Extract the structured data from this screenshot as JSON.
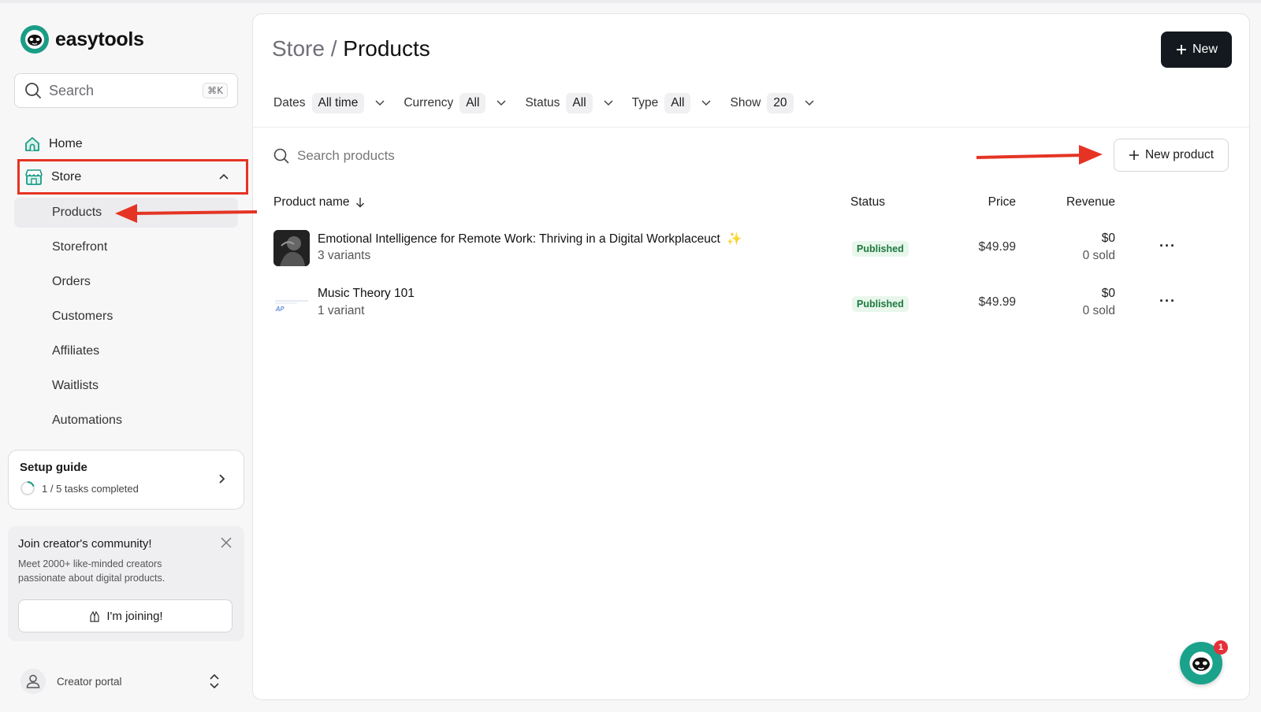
{
  "brand": {
    "name": "easytools"
  },
  "sidebar": {
    "search_placeholder": "Search",
    "search_shortcut": "⌘K",
    "home_label": "Home",
    "store_label": "Store",
    "store_items": [
      {
        "label": "Products",
        "active": true
      },
      {
        "label": "Storefront"
      },
      {
        "label": "Orders"
      },
      {
        "label": "Customers"
      },
      {
        "label": "Affiliates"
      },
      {
        "label": "Waitlists"
      },
      {
        "label": "Automations"
      }
    ],
    "setup_guide": {
      "title": "Setup guide",
      "progress_text": "1 / 5 tasks completed",
      "progress": 0.2
    },
    "community": {
      "title": "Join creator's community!",
      "description": "Meet 2000+ like-minded creators passionate about digital products.",
      "button_label": "I'm joining!"
    },
    "portal_label": "Creator portal"
  },
  "header": {
    "breadcrumb": "Store",
    "separator": "/",
    "title": "Products",
    "new_button": "New"
  },
  "filters": [
    {
      "label": "Dates",
      "value": "All time"
    },
    {
      "label": "Currency",
      "value": "All"
    },
    {
      "label": "Status",
      "value": "All"
    },
    {
      "label": "Type",
      "value": "All"
    },
    {
      "label": "Show",
      "value": "20"
    }
  ],
  "products_search_placeholder": "Search products",
  "new_product_button": "New product",
  "table": {
    "columns": [
      "Product name",
      "Status",
      "Price",
      "Revenue"
    ],
    "rows": [
      {
        "name": "Emotional Intelligence for Remote Work: Thriving in a Digital Workplaceuct",
        "variants": "3 variants",
        "status": "Published",
        "price": "$49.99",
        "revenue": "$0",
        "sold": "0 sold"
      },
      {
        "name": "Music Theory 101",
        "variants": "1 variant",
        "status": "Published",
        "price": "$49.99",
        "revenue": "$0",
        "sold": "0 sold"
      }
    ]
  },
  "chat_badge": "1",
  "colors": {
    "accent": "#1aa28b",
    "annotation": "#e53424",
    "primary_button": "#13191f",
    "published_badge": "#1b7a3d"
  }
}
